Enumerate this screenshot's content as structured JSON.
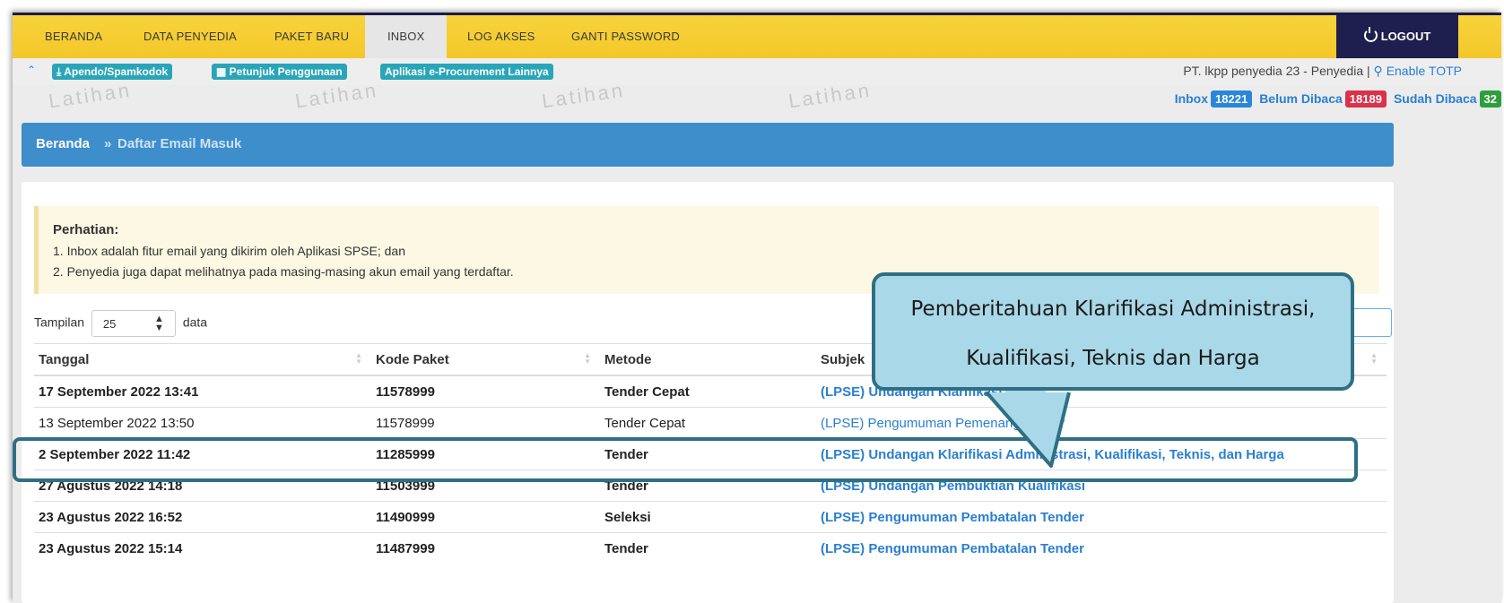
{
  "nav": {
    "items": [
      {
        "label": "BERANDA",
        "active": false
      },
      {
        "label": "DATA PENYEDIA",
        "active": false
      },
      {
        "label": "PAKET BARU",
        "active": false
      },
      {
        "label": "INBOX",
        "active": true
      },
      {
        "label": "LOG AKSES",
        "active": false
      },
      {
        "label": "GANTI PASSWORD",
        "active": false
      }
    ],
    "logout_label": "LOGOUT"
  },
  "toolbar": {
    "apendo": "Apendo/Spamkodok",
    "petunjuk": "Petunjuk Penggunaan",
    "aplikasi": "Aplikasi e-Procurement Lainnya",
    "user_info": "PT. lkpp penyedia 23 - Penyedia |",
    "enable_totp": "Enable TOTP"
  },
  "watermark": "Latihan",
  "counters": {
    "inbox_label": "Inbox",
    "inbox_count": "18221",
    "unread_label": "Belum Dibaca",
    "unread_count": "18189",
    "read_label": "Sudah Dibaca",
    "read_count": "32"
  },
  "breadcrumb": {
    "home": "Beranda",
    "sep": "»",
    "current": "Daftar Email Masuk"
  },
  "notice": {
    "title": "Perhatian:",
    "line1": "1. Inbox adalah fitur email yang dikirim oleh Aplikasi SPSE; dan",
    "line2": "2. Penyedia juga dapat melihatnya pada masing-masing akun email yang terdaftar."
  },
  "length": {
    "prefix": "Tampilan",
    "value": "25",
    "suffix": "data"
  },
  "table": {
    "headers": [
      "Tanggal",
      "Kode Paket",
      "Metode",
      "Subjek"
    ],
    "rows": [
      {
        "date": "17 September 2022 13:41",
        "code": "11578999",
        "method": "Tender Cepat",
        "subject": "(LPSE) Undangan Klarifikasi",
        "unread": true
      },
      {
        "date": "13 September 2022 13:50",
        "code": "11578999",
        "method": "Tender Cepat",
        "subject": "(LPSE) Pengumuman Pemenang Tender",
        "unread": false
      },
      {
        "date": "2 September 2022 11:42",
        "code": "11285999",
        "method": "Tender",
        "subject": "(LPSE) Undangan Klarifikasi Administrasi, Kualifikasi, Teknis, dan Harga",
        "unread": true
      },
      {
        "date": "27 Agustus 2022 14:18",
        "code": "11503999",
        "method": "Tender",
        "subject": "(LPSE) Undangan Pembuktian Kualifikasi",
        "unread": true
      },
      {
        "date": "23 Agustus 2022 16:52",
        "code": "11490999",
        "method": "Seleksi",
        "subject": "(LPSE) Pengumuman Pembatalan Tender",
        "unread": true
      },
      {
        "date": "23 Agustus 2022 15:14",
        "code": "11487999",
        "method": "Tender",
        "subject": "(LPSE) Pengumuman Pembatalan Tender",
        "unread": true
      }
    ]
  },
  "callout": {
    "line1": "Pemberitahuan Klarifikasi Administrasi,",
    "line2": "Kualifikasi, Teknis dan Harga"
  },
  "colors": {
    "nav": "#f4c72a",
    "logout": "#1f1f4f",
    "breadcrumb": "#3d8ecb",
    "callout": "#a9d8e8",
    "callout_border": "#2f6f84"
  }
}
